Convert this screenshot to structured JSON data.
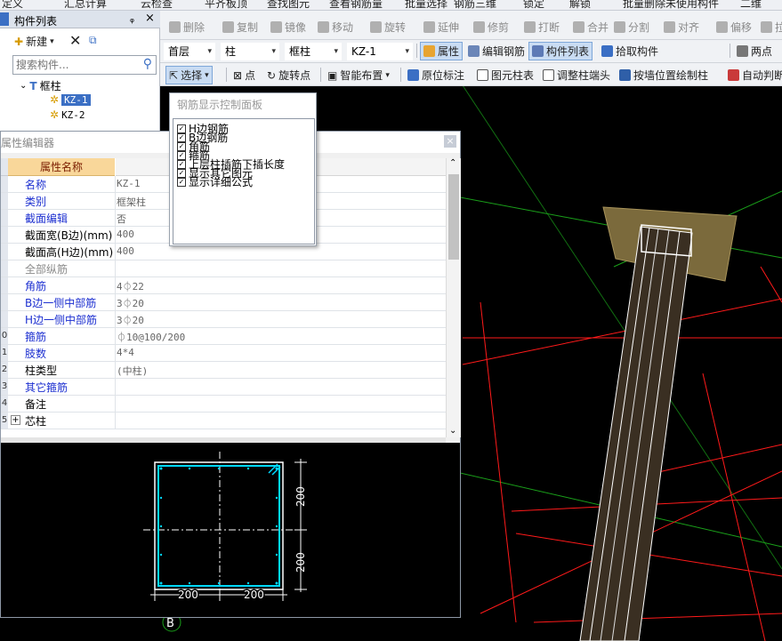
{
  "row0": [
    "定义",
    "汇总计算",
    "云检查",
    "平齐板顶",
    "查找图元",
    "查看钢筋量",
    "批量选择",
    "钢筋三维",
    "锁定",
    "解锁",
    "批量删除未使用构件",
    "二维"
  ],
  "component_panel": {
    "title": "构件列表",
    "pin": "ᵩ",
    "close": "×",
    "new_label": "新建",
    "search_placeholder": "搜索构件...",
    "tree": {
      "group": "框柱",
      "items": [
        "KZ-1",
        "KZ-2"
      ],
      "selected": "KZ-1"
    }
  },
  "edit_toolbar": {
    "items": [
      {
        "label": "删除",
        "icon": "delete-icon"
      },
      {
        "label": "复制",
        "icon": "copy-icon"
      },
      {
        "label": "镜像",
        "icon": "mirror-icon"
      },
      {
        "label": "移动",
        "icon": "move-icon"
      },
      {
        "label": "旋转",
        "icon": "rotate-icon"
      },
      {
        "label": "延伸",
        "icon": "extend-icon"
      },
      {
        "label": "修剪",
        "icon": "trim-icon"
      },
      {
        "label": "打断",
        "icon": "break-icon"
      },
      {
        "label": "合并",
        "icon": "merge-icon"
      },
      {
        "label": "分割",
        "icon": "split-icon"
      },
      {
        "label": "对齐",
        "icon": "align-icon"
      },
      {
        "label": "偏移",
        "icon": "offset-icon"
      },
      {
        "label": "拉伸",
        "icon": "stretch-icon"
      }
    ]
  },
  "filter_toolbar": {
    "floor": "首层",
    "type": "柱",
    "subtype": "框柱",
    "component": "KZ-1",
    "buttons": [
      "属性",
      "编辑钢筋",
      "构件列表",
      "拾取构件"
    ],
    "two_point": "两点"
  },
  "draw_toolbar": {
    "items": [
      "选择",
      "点",
      "旋转点",
      "智能布置",
      "原位标注",
      "图元柱表",
      "调整柱端头",
      "按墙位置绘制柱",
      "自动判断"
    ]
  },
  "rebar_panel": {
    "title": "钢筋显示控制面板",
    "options": [
      {
        "label": "H边钢筋",
        "checked": true
      },
      {
        "label": "B边钢筋",
        "checked": true
      },
      {
        "label": "角筋",
        "checked": true
      },
      {
        "label": "箍筋",
        "checked": true
      },
      {
        "label": "上层柱插筋下插长度",
        "checked": true
      },
      {
        "label": "显示其它图元",
        "checked": true
      },
      {
        "label": "显示详细公式",
        "checked": true
      }
    ]
  },
  "property_editor": {
    "title": "属性编辑器",
    "header": "属性名称",
    "rows": [
      {
        "num": "",
        "name": "名称",
        "value": "KZ-1",
        "style": "blue"
      },
      {
        "num": "",
        "name": "类别",
        "value": "框架柱",
        "style": "blue"
      },
      {
        "num": "",
        "name": "截面编辑",
        "value": "否",
        "style": "blue"
      },
      {
        "num": "",
        "name": "截面宽(B边)(mm)",
        "value": "400",
        "style": "black"
      },
      {
        "num": "",
        "name": "截面高(H边)(mm)",
        "value": "400",
        "style": "black"
      },
      {
        "num": "",
        "name": "全部纵筋",
        "value": "",
        "style": "gray"
      },
      {
        "num": "",
        "name": "角筋",
        "value": "4⏀22",
        "style": "blue"
      },
      {
        "num": "",
        "name": "B边一侧中部筋",
        "value": "3⏀20",
        "style": "blue"
      },
      {
        "num": "",
        "name": "H边一侧中部筋",
        "value": "3⏀20",
        "style": "blue"
      },
      {
        "num": "0",
        "name": "箍筋",
        "value": "⏀10@100/200",
        "style": "blue"
      },
      {
        "num": "1",
        "name": "肢数",
        "value": "4*4",
        "style": "blue"
      },
      {
        "num": "2",
        "name": "柱类型",
        "value": "(中柱)",
        "style": "black"
      },
      {
        "num": "3",
        "name": "其它箍筋",
        "value": "",
        "style": "blue"
      },
      {
        "num": "4",
        "name": "备注",
        "value": "",
        "style": "black"
      },
      {
        "num": "5",
        "name": "芯柱",
        "value": "",
        "style": "black",
        "expand": "+"
      }
    ]
  },
  "section_preview": {
    "dim_top": "200",
    "dim_bottom": "200",
    "dim_left": "200",
    "dim_right": "200",
    "axis_label": "B"
  },
  "colors": {
    "accent_blue": "#1c2fd0",
    "header_bg": "#f9d79a",
    "rebar_cyan": "#00d8ff",
    "grid_red": "#ff1a1a",
    "grid_green": "#1aa01a",
    "column_fill": "#7b6a3c"
  }
}
